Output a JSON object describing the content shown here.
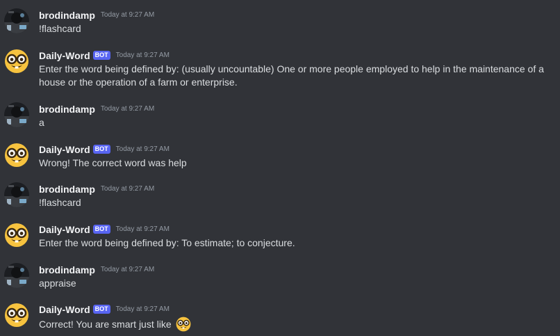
{
  "bot_tag": "BOT",
  "messages": [
    {
      "author": "brodindamp",
      "timestamp": "Today at 9:27 AM",
      "text": "!flashcard",
      "avatar_icon": "user-avatar-icon",
      "is_bot": false
    },
    {
      "author": "Daily-Word",
      "timestamp": "Today at 9:27 AM",
      "text": "Enter the word being defined by: (usually uncountable) One or more people employed to help in the maintenance of a house or the operation of a farm or enterprise.",
      "avatar_icon": "nerd-face-icon",
      "is_bot": true
    },
    {
      "author": "brodindamp",
      "timestamp": "Today at 9:27 AM",
      "text": "a",
      "avatar_icon": "user-avatar-icon",
      "is_bot": false
    },
    {
      "author": "Daily-Word",
      "timestamp": "Today at 9:27 AM",
      "text": "Wrong! The correct word was help",
      "avatar_icon": "nerd-face-icon",
      "is_bot": true
    },
    {
      "author": "brodindamp",
      "timestamp": "Today at 9:27 AM",
      "text": "!flashcard",
      "avatar_icon": "user-avatar-icon",
      "is_bot": false
    },
    {
      "author": "Daily-Word",
      "timestamp": "Today at 9:27 AM",
      "text": "Enter the word being defined by: To estimate; to conjecture.",
      "avatar_icon": "nerd-face-icon",
      "is_bot": true
    },
    {
      "author": "brodindamp",
      "timestamp": "Today at 9:27 AM",
      "text": "appraise",
      "avatar_icon": "user-avatar-icon",
      "is_bot": false
    },
    {
      "author": "Daily-Word",
      "timestamp": "Today at 9:27 AM",
      "text": "Correct! You are smart just like",
      "trailing_emoji": "nerd-face-emoji-icon",
      "avatar_icon": "nerd-face-icon",
      "is_bot": true
    }
  ],
  "colors": {
    "background": "#313338",
    "username": "#f2f3f5",
    "message_text": "#dbdee1",
    "timestamp": "#949ba4",
    "bot_tag": "#5865f2"
  }
}
